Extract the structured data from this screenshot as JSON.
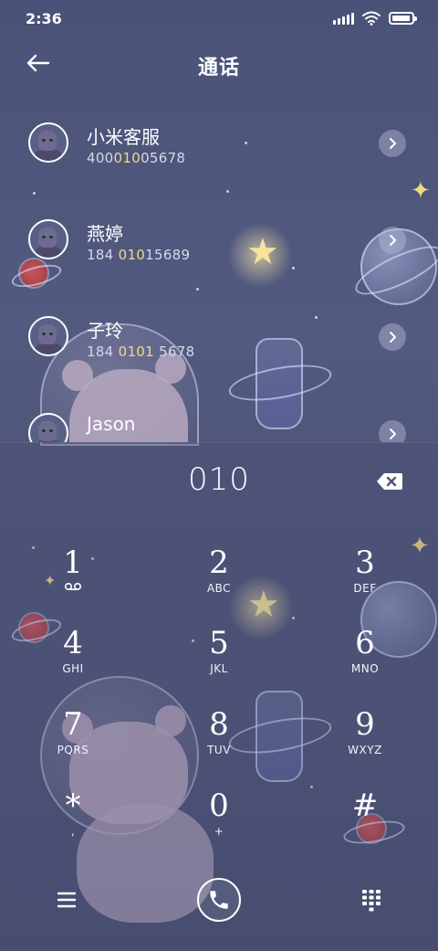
{
  "status_bar": {
    "time": "2:36",
    "battery_level": 0.95,
    "signal_bars": 4
  },
  "header": {
    "title": "通话",
    "back_icon": "arrow-left-icon"
  },
  "contacts": [
    {
      "name": "小米客服",
      "number_parts": [
        {
          "t": "400",
          "h": false
        },
        {
          "t": "010",
          "h": true
        },
        {
          "t": "05678",
          "h": false
        }
      ]
    },
    {
      "name": "燕婷",
      "number_parts": [
        {
          "t": "184 ",
          "h": false
        },
        {
          "t": "010",
          "h": true
        },
        {
          "t": "15689",
          "h": false
        }
      ]
    },
    {
      "name": "子玲",
      "number_parts": [
        {
          "t": "184 ",
          "h": false
        },
        {
          "t": "0101",
          "h": true
        },
        {
          "t": " 5678",
          "h": false
        }
      ]
    },
    {
      "name": "Jason",
      "number_parts": []
    }
  ],
  "dialer": {
    "dialed_number": "010",
    "keys": [
      {
        "digit": "1",
        "letters": "",
        "icon": "voicemail-icon"
      },
      {
        "digit": "2",
        "letters": "ABC"
      },
      {
        "digit": "3",
        "letters": "DEF"
      },
      {
        "digit": "4",
        "letters": "GHI"
      },
      {
        "digit": "5",
        "letters": "JKL"
      },
      {
        "digit": "6",
        "letters": "MNO"
      },
      {
        "digit": "7",
        "letters": "PQRS"
      },
      {
        "digit": "8",
        "letters": "TUV"
      },
      {
        "digit": "9",
        "letters": "WXYZ"
      },
      {
        "digit": "*",
        "letters": ","
      },
      {
        "digit": "0",
        "letters": "+"
      },
      {
        "digit": "#",
        "letters": ""
      }
    ]
  },
  "bottom_bar": {
    "menu_icon": "menu-icon",
    "call_icon": "phone-icon",
    "keypad_icon": "dialpad-icon"
  },
  "colors": {
    "background": "#4f5679",
    "match_highlight": "#f0d98a",
    "text": "#ffffff"
  }
}
